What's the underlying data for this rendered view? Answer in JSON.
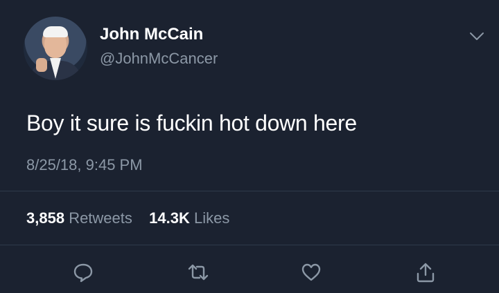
{
  "tweet": {
    "author_name": "John McCain",
    "author_handle": "@JohnMcCancer",
    "text": "Boy it sure is fuckin hot down here",
    "timestamp": "8/25/18, 9:45 PM"
  },
  "stats": {
    "retweets_count": "3,858",
    "retweets_label": "Retweets",
    "likes_count": "14.3K",
    "likes_label": "Likes"
  },
  "icons": {
    "menu": "chevron-down-icon",
    "reply": "reply-icon",
    "retweet": "retweet-icon",
    "like": "heart-icon",
    "share": "share-icon"
  },
  "colors": {
    "background": "#1b2230",
    "primary_text": "#ffffff",
    "secondary_text": "#8c98a6",
    "divider": "#2f3a4b"
  }
}
